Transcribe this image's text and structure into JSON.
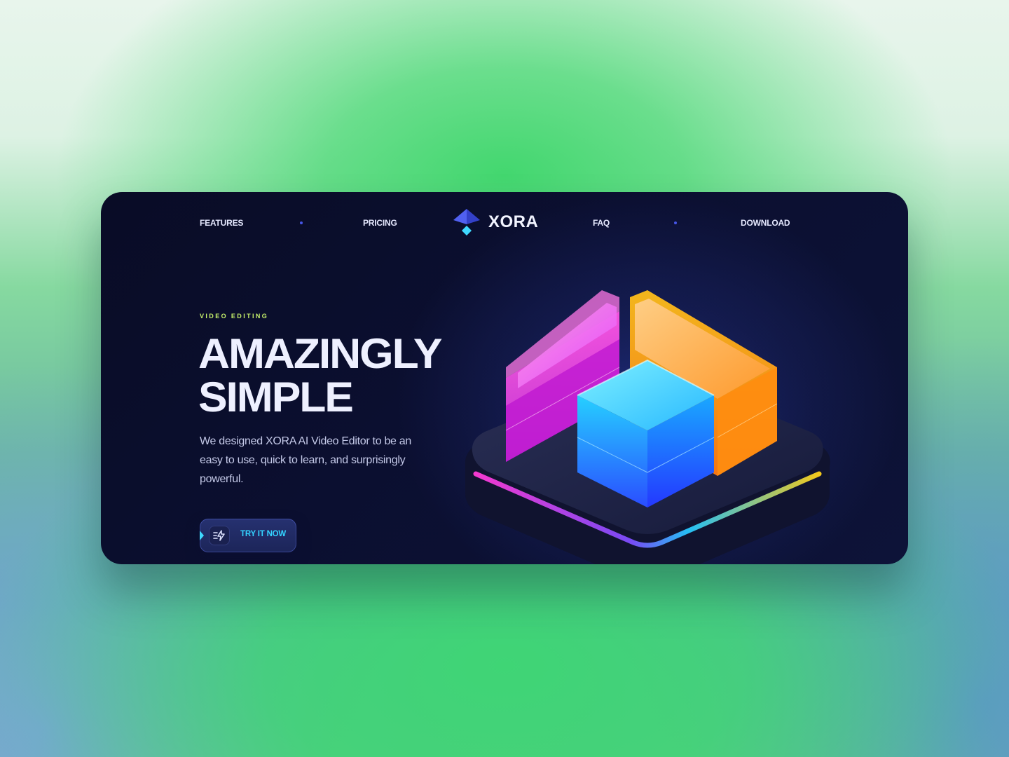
{
  "nav": {
    "left_items": [
      {
        "label": "FEATURES"
      },
      {
        "label": "PRICING"
      }
    ],
    "right_items": [
      {
        "label": "FAQ"
      },
      {
        "label": "DOWNLOAD"
      }
    ],
    "logo_text": "XORA"
  },
  "hero": {
    "eyebrow": "VIDEO EDITING",
    "headline_line1": "AMAZINGLY",
    "headline_line2": "SIMPLE",
    "description": "We designed XORA AI Video Editor to be an easy to use, quick to learn, and surprisingly powerful.",
    "cta_label": "TRY IT NOW",
    "cta_icon": "lightning-icon"
  },
  "colors": {
    "card_background": "#0a0d2c",
    "accent_blue": "#4756e8",
    "eyebrow_green": "#c7f26b",
    "cta_text": "#33d3ff",
    "page_background_green": "#43d76f"
  }
}
